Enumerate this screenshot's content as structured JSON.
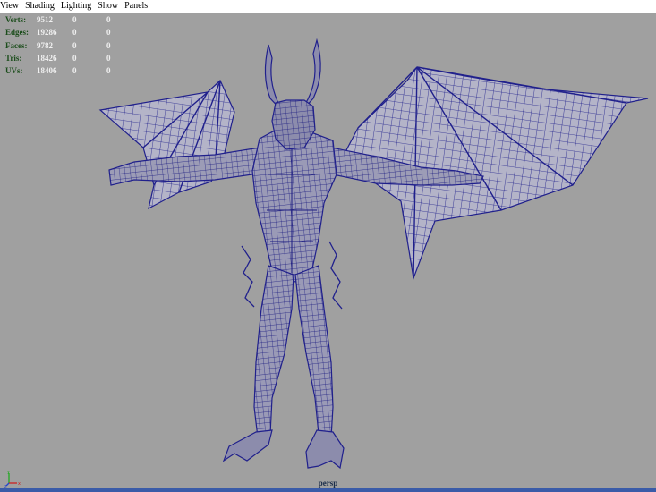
{
  "menu": [
    "View",
    "Shading",
    "Lighting",
    "Show",
    "Panels"
  ],
  "hud": [
    {
      "label": "Verts:",
      "v1": "9512",
      "v2": "0",
      "v3": "0"
    },
    {
      "label": "Edges:",
      "v1": "19286",
      "v2": "0",
      "v3": "0"
    },
    {
      "label": "Faces:",
      "v1": "9782",
      "v2": "0",
      "v3": "0"
    },
    {
      "label": "Tris:",
      "v1": "18426",
      "v2": "0",
      "v3": "0"
    },
    {
      "label": "UVs:",
      "v1": "18406",
      "v2": "0",
      "v3": "0"
    }
  ],
  "camera_label": "persp",
  "colors": {
    "viewport_bg": "#a0a0a0",
    "wireframe": "#20208c",
    "hud_label": "#1b4d1b",
    "hud_value": "#f0f0f0"
  }
}
